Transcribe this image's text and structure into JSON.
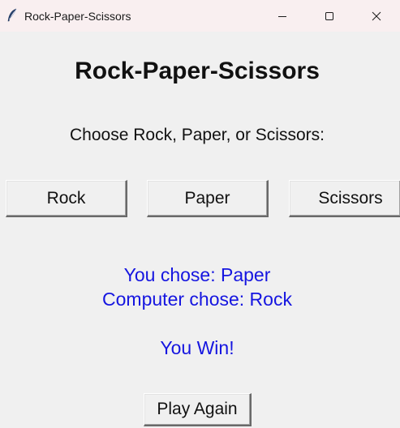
{
  "window": {
    "title": "Rock-Paper-Scissors",
    "icon": "feather-icon",
    "controls": {
      "minimize_icon": "minimize-icon",
      "maximize_icon": "maximize-icon",
      "close_icon": "close-icon"
    }
  },
  "game": {
    "heading": "Rock-Paper-Scissors",
    "prompt": "Choose Rock, Paper, or Scissors:",
    "choices": {
      "rock": "Rock",
      "paper": "Paper",
      "scissors": "Scissors"
    },
    "result": {
      "user_choice": "You chose: Paper",
      "computer_choice": "Computer chose: Rock",
      "outcome": "You Win!"
    },
    "play_again": "Play Again"
  },
  "colors": {
    "background": "#f0f0f0",
    "titlebar": "#f9eff0",
    "result_text": "#1515e0"
  }
}
